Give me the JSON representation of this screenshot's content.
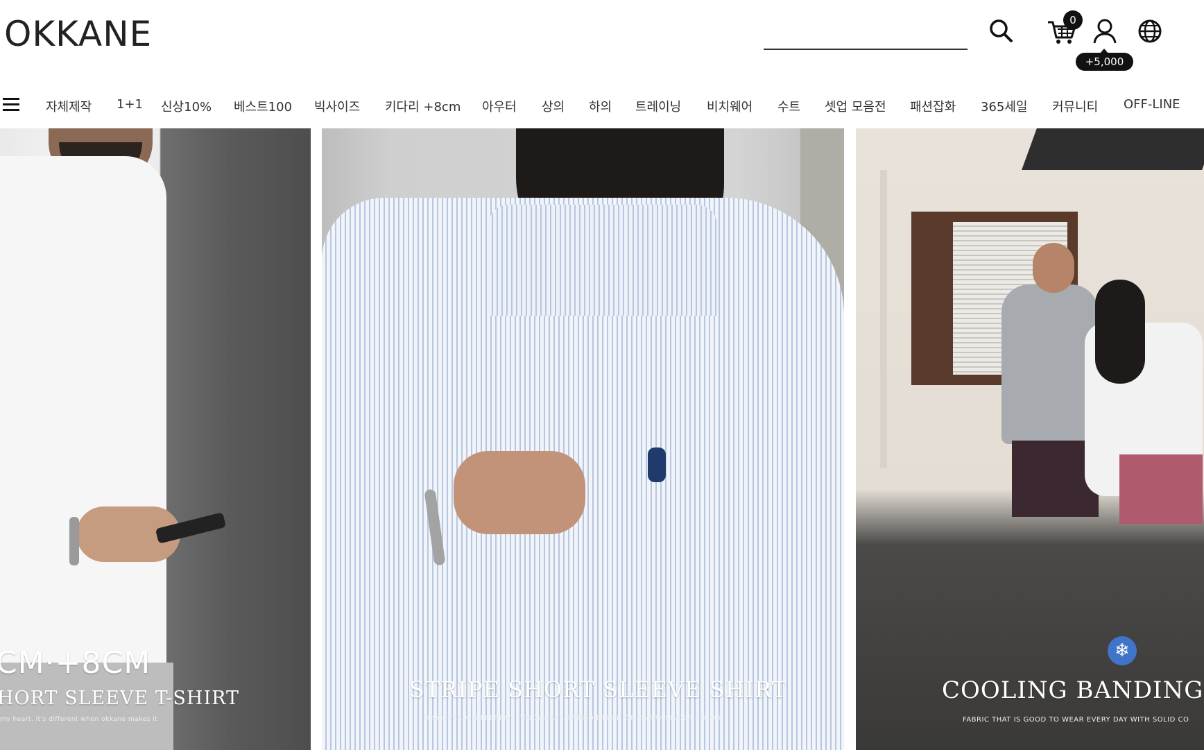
{
  "header": {
    "logo": "OKKANE",
    "search_placeholder": "",
    "cart_count": "0",
    "points_badge": "+5,000"
  },
  "nav": {
    "items": [
      "자체제작",
      "1+1",
      "신상10%",
      "베스트100",
      "빅사이즈",
      "키다리 +8cm",
      "아우터",
      "상의",
      "하의",
      "트레이닝",
      "비치웨어",
      "수트",
      "셋업 모음전",
      "패션잡화",
      "365세일",
      "커뮤니티",
      "OFF-LINE"
    ]
  },
  "banners": [
    {
      "title_line1": "CM·+8CM",
      "title_line2": "HORT SLEEVE T-SHIRT",
      "subtitle": "my heart, it's different when okkane makes it"
    },
    {
      "title": "STRIPE SHORT SLEEVE  SHIRT",
      "subtitle": "DISCOVER A DIFFERENT TEDDY BEAR EMBROIDERED ON EVERY SINGLE COLOR."
    },
    {
      "title": "COOLING BANDING",
      "subtitle": "FABRIC THAT IS GOOD TO WEAR EVERY DAY WITH SOLID CO"
    }
  ],
  "icons": {
    "search": "search-icon",
    "cart": "cart-icon",
    "user": "user-icon",
    "globe": "globe-icon",
    "menu": "hamburger-menu-icon"
  }
}
